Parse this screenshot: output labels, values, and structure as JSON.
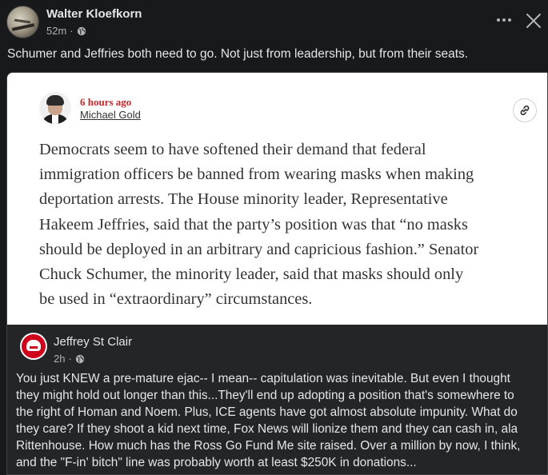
{
  "post": {
    "author": "Walter Kloefkorn",
    "time": "52m",
    "dot": "·",
    "text": "Schumer and Jeffries both need to go. Not just from leadership, but from their seats."
  },
  "article": {
    "time_ago": "6 hours ago",
    "byline": "Michael Gold",
    "lines": [
      "Democrats seem to have softened their demand that federal",
      "immigration officers be banned from wearing masks when making",
      "deportation arrests. The House minority leader, Representative",
      "Hakeem Jeffries, said that the party’s position was that “no masks",
      "should be deployed in an arbitrary and capricious fashion.” Senator",
      "Chuck Schumer, the minority leader, said that masks should only",
      "be used in “extraordinary” circumstances."
    ]
  },
  "shared_post": {
    "author": "Jeffrey St Clair",
    "time": "2h",
    "dot": "·",
    "lines": [
      "You just KNEW a pre-mature ejac-- I mean-- capitulation was inevitable. But even I thought",
      "they might hold out longer than this...They'll end up adopting a position that's somewhere to",
      "the right of Homan and Noem. Plus, ICE agents have got almost absolute impunity. What do",
      "they care? If they shoot a kid next time, Fox News will lionize them and they can cash in, ala",
      "Rittenhouse. How much has the Ross Go Fund Me site raised. Over a million by now, I think,",
      "and the \"F-in' bitch\" line was probably worth at least $250K in donations..."
    ]
  },
  "icons": {
    "privacy": "globe-icon",
    "menu": "more-options-icon",
    "close": "close-icon",
    "link": "link-icon"
  },
  "colors": {
    "background": "#18191a",
    "card": "#242526",
    "nyt_timestamp": "#c3272b",
    "text_primary": "#e4e6eb",
    "text_secondary": "#b0b3b8"
  }
}
